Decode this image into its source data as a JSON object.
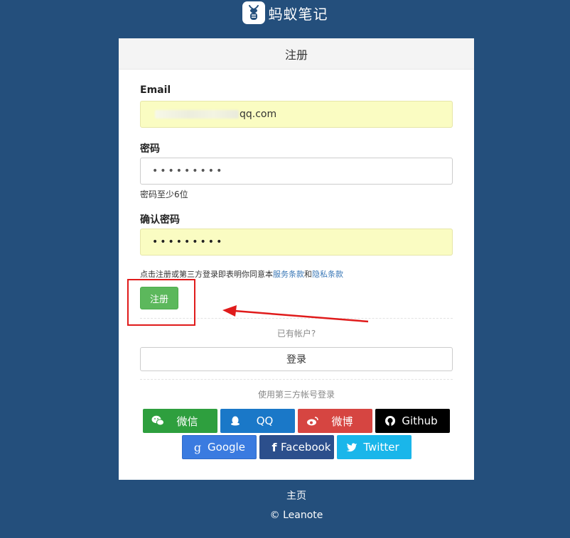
{
  "brand": {
    "app_name": "蚂蚁笔记"
  },
  "form": {
    "title": "注册",
    "email_label": "Email",
    "email_value_visible": "qq.com",
    "password_label": "密码",
    "password_value": "•••••••••",
    "password_hint": "密码至少6位",
    "confirm_label": "确认密码",
    "confirm_value": "•••••••••",
    "terms_prefix": "点击注册或第三方登录即表明你同意本",
    "terms_service": "服务条款",
    "terms_and": "和",
    "terms_privacy": "隐私条款",
    "submit_label": "注册",
    "have_account": "已有帐户?",
    "login_label": "登录",
    "third_party_label": "使用第三方帐号登录"
  },
  "social": [
    {
      "label": "微信",
      "icon": "wechat-icon",
      "color": "#2e9f3e"
    },
    {
      "label": "QQ",
      "icon": "qq-icon",
      "color": "#1a78c8"
    },
    {
      "label": "微博",
      "icon": "weibo-icon",
      "color": "#d64541"
    },
    {
      "label": "Github",
      "icon": "github-icon",
      "color": "#000000"
    },
    {
      "label": "Google",
      "icon": "google-icon",
      "color": "#3a7be0"
    },
    {
      "label": "Facebook",
      "icon": "facebook-icon",
      "color": "#2c4f8c"
    },
    {
      "label": "Twitter",
      "icon": "twitter-icon",
      "color": "#1ab6ea"
    }
  ],
  "footer": {
    "home_link": "主页",
    "copyright": "© Leanote"
  },
  "colors": {
    "page_background": "#244f7c",
    "primary_button": "#5cb85c",
    "link": "#3a78b7",
    "annotation": "#e01b1b"
  }
}
